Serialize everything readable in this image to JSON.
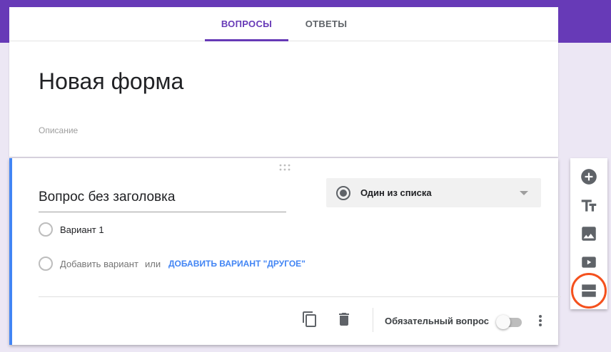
{
  "tabs": [
    {
      "label": "ВОПРОСЫ",
      "active": true
    },
    {
      "label": "ОТВЕТЫ",
      "active": false
    }
  ],
  "form": {
    "title": "Новая форма",
    "description_placeholder": "Описание"
  },
  "question": {
    "title": "Вопрос без заголовка",
    "type_label": "Один из списка",
    "options": [
      "Вариант 1"
    ],
    "add_option_label": "Добавить вариант",
    "or_label": "или",
    "add_other_label": "ДОБАВИТЬ ВАРИАНТ \"ДРУГОЕ\"",
    "required_label": "Обязательный вопрос",
    "required": false
  },
  "sidebar": {
    "items": [
      "add-question-icon",
      "add-title-icon",
      "add-image-icon",
      "add-video-icon",
      "add-section-icon"
    ]
  },
  "colors": {
    "accent": "#673ab7",
    "focus": "#4285f4",
    "highlight": "#f4511e"
  }
}
